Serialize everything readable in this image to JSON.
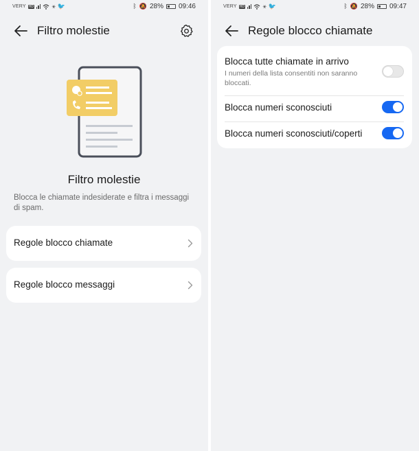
{
  "status_left": {
    "carrier": "VERY",
    "hd": "HD",
    "battery": "28%",
    "time": "09:46",
    "battery_level": 0.28
  },
  "status_right": {
    "carrier": "VERY",
    "hd": "HD",
    "battery": "28%",
    "time": "09:47",
    "battery_level": 0.28
  },
  "screen1": {
    "title": "Filtro molestie",
    "heading": "Filtro molestie",
    "description": "Blocca le chiamate indesiderate e filtra i messaggi di spam.",
    "items": [
      {
        "label": "Regole blocco chiamate"
      },
      {
        "label": "Regole blocco messaggi"
      }
    ],
    "icons": {
      "back": "arrow-left-icon",
      "settings": "gear-icon",
      "chevron": "chevron-right-icon"
    }
  },
  "screen2": {
    "title": "Regole blocco chiamate",
    "rows": [
      {
        "label": "Blocca tutte chiamate in arrivo",
        "sublabel": "I numeri della lista consentiti non saranno bloccati.",
        "enabled": false
      },
      {
        "label": "Blocca numeri sconosciuti",
        "enabled": true
      },
      {
        "label": "Blocca numeri sconosciuti/coperti",
        "enabled": true
      }
    ]
  },
  "colors": {
    "accent": "#1668f2",
    "background": "#f1f2f4",
    "illustration_yellow": "#f2cd66"
  }
}
